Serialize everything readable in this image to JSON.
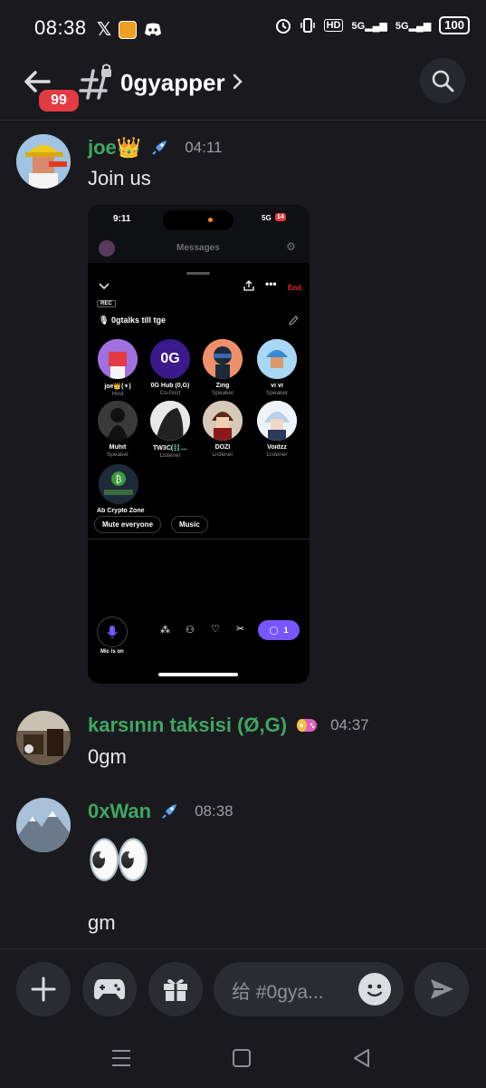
{
  "status_bar": {
    "time": "08:38",
    "battery": "100",
    "hd_label": "HD",
    "net1": "5G",
    "net2": "5G"
  },
  "header": {
    "back_badge": "99",
    "channel_name": "0gyapper"
  },
  "messages": [
    {
      "username": "joe👑",
      "time": "04:11",
      "text": "Join us",
      "badge_icon": "rocket-icon"
    },
    {
      "username": "karsının taksisi (Ø,G)",
      "time": "04:37",
      "text": "0gm",
      "badge_icon": "gamepad-badge-icon"
    },
    {
      "username": "0xWan",
      "time": "08:38",
      "emoji": "👀",
      "text": "gm",
      "badge_icon": "rocket-icon"
    }
  ],
  "embed": {
    "status_time": "9:11",
    "status_net": "5G",
    "status_battery": "14",
    "messages_title": "Messages",
    "end_label": "End",
    "rec_label": "REC",
    "space_title": "0gtalks till tge",
    "speakers": [
      {
        "name": "joe👑(✶)",
        "role": "Host"
      },
      {
        "name": "0G Hub (0,G)",
        "role": "Co-host"
      },
      {
        "name": "Zing",
        "role": "Speaker"
      },
      {
        "name": "vi vi",
        "role": "Speaker"
      },
      {
        "name": "Muhit",
        "role": "Speaker"
      },
      {
        "name": "TW3C(⛓️…",
        "role": "Listener"
      },
      {
        "name": "DOZI",
        "role": "Listener"
      },
      {
        "name": "Voidzz",
        "role": "Listener"
      },
      {
        "name": "Ab Crypto Zone",
        "role": ""
      }
    ],
    "mute_everyone": "Mute everyone",
    "music": "Music",
    "mic_label": "Mic is on",
    "reply_count": "1"
  },
  "composer": {
    "placeholder": "给 #0gya..."
  },
  "colors": {
    "background": "#1a1a1e",
    "username_green": "#3fa662",
    "badge_red": "#e23b43",
    "space_purple": "#7856ff"
  }
}
